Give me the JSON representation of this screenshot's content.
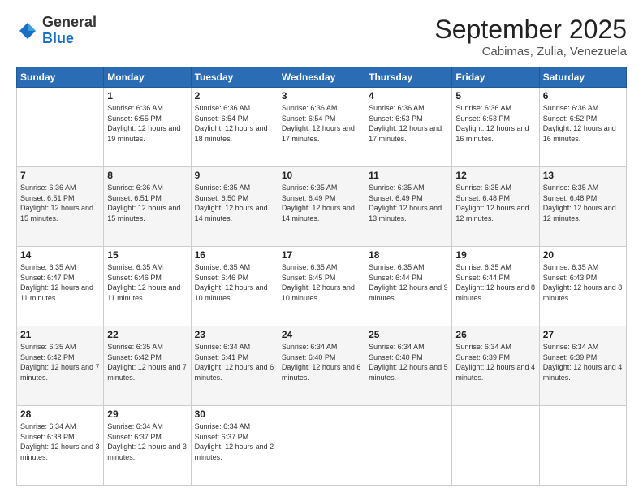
{
  "header": {
    "logo_general": "General",
    "logo_blue": "Blue",
    "month": "September 2025",
    "location": "Cabimas, Zulia, Venezuela"
  },
  "weekdays": [
    "Sunday",
    "Monday",
    "Tuesday",
    "Wednesday",
    "Thursday",
    "Friday",
    "Saturday"
  ],
  "weeks": [
    [
      {
        "day": "",
        "sunrise": "",
        "sunset": "",
        "daylight": ""
      },
      {
        "day": "1",
        "sunrise": "6:36 AM",
        "sunset": "6:55 PM",
        "daylight": "12 hours and 19 minutes."
      },
      {
        "day": "2",
        "sunrise": "6:36 AM",
        "sunset": "6:54 PM",
        "daylight": "12 hours and 18 minutes."
      },
      {
        "day": "3",
        "sunrise": "6:36 AM",
        "sunset": "6:54 PM",
        "daylight": "12 hours and 17 minutes."
      },
      {
        "day": "4",
        "sunrise": "6:36 AM",
        "sunset": "6:53 PM",
        "daylight": "12 hours and 17 minutes."
      },
      {
        "day": "5",
        "sunrise": "6:36 AM",
        "sunset": "6:53 PM",
        "daylight": "12 hours and 16 minutes."
      },
      {
        "day": "6",
        "sunrise": "6:36 AM",
        "sunset": "6:52 PM",
        "daylight": "12 hours and 16 minutes."
      }
    ],
    [
      {
        "day": "7",
        "sunrise": "6:36 AM",
        "sunset": "6:51 PM",
        "daylight": "12 hours and 15 minutes."
      },
      {
        "day": "8",
        "sunrise": "6:36 AM",
        "sunset": "6:51 PM",
        "daylight": "12 hours and 15 minutes."
      },
      {
        "day": "9",
        "sunrise": "6:35 AM",
        "sunset": "6:50 PM",
        "daylight": "12 hours and 14 minutes."
      },
      {
        "day": "10",
        "sunrise": "6:35 AM",
        "sunset": "6:49 PM",
        "daylight": "12 hours and 14 minutes."
      },
      {
        "day": "11",
        "sunrise": "6:35 AM",
        "sunset": "6:49 PM",
        "daylight": "12 hours and 13 minutes."
      },
      {
        "day": "12",
        "sunrise": "6:35 AM",
        "sunset": "6:48 PM",
        "daylight": "12 hours and 12 minutes."
      },
      {
        "day": "13",
        "sunrise": "6:35 AM",
        "sunset": "6:48 PM",
        "daylight": "12 hours and 12 minutes."
      }
    ],
    [
      {
        "day": "14",
        "sunrise": "6:35 AM",
        "sunset": "6:47 PM",
        "daylight": "12 hours and 11 minutes."
      },
      {
        "day": "15",
        "sunrise": "6:35 AM",
        "sunset": "6:46 PM",
        "daylight": "12 hours and 11 minutes."
      },
      {
        "day": "16",
        "sunrise": "6:35 AM",
        "sunset": "6:46 PM",
        "daylight": "12 hours and 10 minutes."
      },
      {
        "day": "17",
        "sunrise": "6:35 AM",
        "sunset": "6:45 PM",
        "daylight": "12 hours and 10 minutes."
      },
      {
        "day": "18",
        "sunrise": "6:35 AM",
        "sunset": "6:44 PM",
        "daylight": "12 hours and 9 minutes."
      },
      {
        "day": "19",
        "sunrise": "6:35 AM",
        "sunset": "6:44 PM",
        "daylight": "12 hours and 8 minutes."
      },
      {
        "day": "20",
        "sunrise": "6:35 AM",
        "sunset": "6:43 PM",
        "daylight": "12 hours and 8 minutes."
      }
    ],
    [
      {
        "day": "21",
        "sunrise": "6:35 AM",
        "sunset": "6:42 PM",
        "daylight": "12 hours and 7 minutes."
      },
      {
        "day": "22",
        "sunrise": "6:35 AM",
        "sunset": "6:42 PM",
        "daylight": "12 hours and 7 minutes."
      },
      {
        "day": "23",
        "sunrise": "6:34 AM",
        "sunset": "6:41 PM",
        "daylight": "12 hours and 6 minutes."
      },
      {
        "day": "24",
        "sunrise": "6:34 AM",
        "sunset": "6:40 PM",
        "daylight": "12 hours and 6 minutes."
      },
      {
        "day": "25",
        "sunrise": "6:34 AM",
        "sunset": "6:40 PM",
        "daylight": "12 hours and 5 minutes."
      },
      {
        "day": "26",
        "sunrise": "6:34 AM",
        "sunset": "6:39 PM",
        "daylight": "12 hours and 4 minutes."
      },
      {
        "day": "27",
        "sunrise": "6:34 AM",
        "sunset": "6:39 PM",
        "daylight": "12 hours and 4 minutes."
      }
    ],
    [
      {
        "day": "28",
        "sunrise": "6:34 AM",
        "sunset": "6:38 PM",
        "daylight": "12 hours and 3 minutes."
      },
      {
        "day": "29",
        "sunrise": "6:34 AM",
        "sunset": "6:37 PM",
        "daylight": "12 hours and 3 minutes."
      },
      {
        "day": "30",
        "sunrise": "6:34 AM",
        "sunset": "6:37 PM",
        "daylight": "12 hours and 2 minutes."
      },
      {
        "day": "",
        "sunrise": "",
        "sunset": "",
        "daylight": ""
      },
      {
        "day": "",
        "sunrise": "",
        "sunset": "",
        "daylight": ""
      },
      {
        "day": "",
        "sunrise": "",
        "sunset": "",
        "daylight": ""
      },
      {
        "day": "",
        "sunrise": "",
        "sunset": "",
        "daylight": ""
      }
    ]
  ]
}
